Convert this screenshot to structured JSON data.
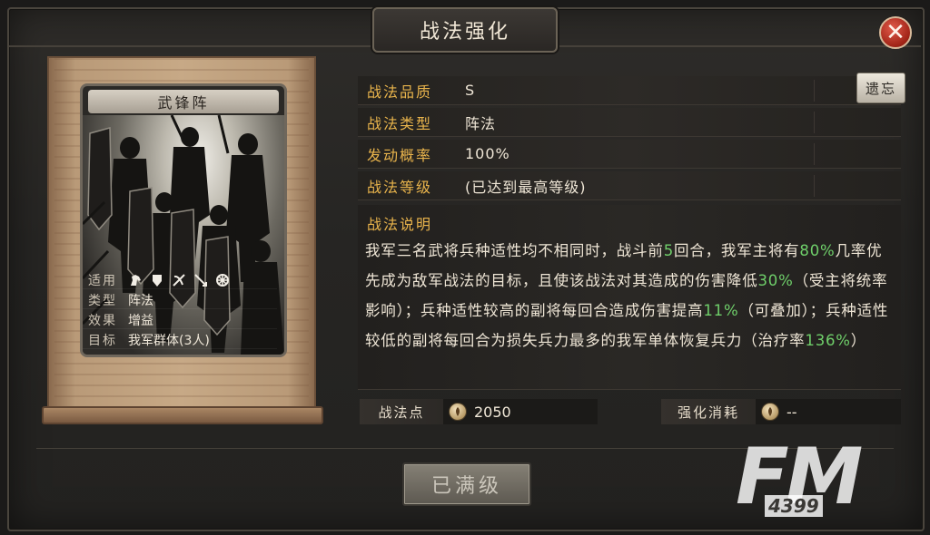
{
  "window": {
    "title": "战法强化"
  },
  "card": {
    "name": "武锋阵",
    "stats": {
      "applicable_label": "适用",
      "applicable_icons": [
        "horse-icon",
        "shield-icon",
        "bow-icon",
        "spear-icon",
        "wheel-icon"
      ],
      "type_label": "类型",
      "type_value": "阵法",
      "effect_label": "效果",
      "effect_value": "增益",
      "target_label": "目标",
      "target_value": "我军群体(3人)"
    }
  },
  "info": {
    "quality_label": "战法品质",
    "quality_value": "S",
    "type_label": "战法类型",
    "type_value": "阵法",
    "rate_label": "发动概率",
    "rate_value": "100%",
    "level_label": "战法等级",
    "level_value": "(已达到最高等级)",
    "legacy_button": "遗忘"
  },
  "description": {
    "title": "战法说明",
    "parts": [
      "我军三名武将兵种适性均不相同时，战斗前",
      "5",
      "回合，我军主将有",
      "80%",
      "几率优先成为敌军战法的目标，且使该战法对其造成的伤害降低",
      "30%",
      "（受主将统率影响）；兵种适性较高的副将每回合造成伤害提高",
      "11%",
      "（可叠加）；兵种适性较低的副将每回合为损失兵力最多的我军单体恢复兵力（治疗率",
      "136%",
      "）"
    ]
  },
  "resources": {
    "points_label": "战法点",
    "points_value": "2050",
    "cost_label": "强化消耗",
    "cost_value": "--"
  },
  "max_button": "已满级",
  "watermark": {
    "brand": "FM",
    "sub": "4399"
  },
  "colors": {
    "accent": "#e9b44c",
    "highlight": "#6fcf6a",
    "close": "#a02316"
  }
}
